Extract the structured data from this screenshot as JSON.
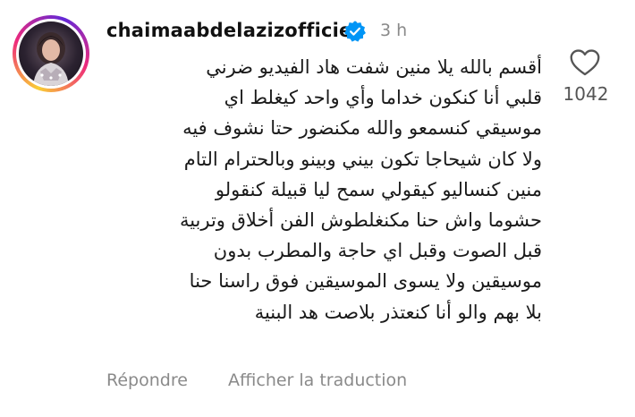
{
  "comment": {
    "author": {
      "username": "chaimaabdelazizofficiel",
      "verified": true,
      "verified_badge_icon": "verified-badge-icon",
      "avatar_icon": "profile-avatar",
      "story_ring_colors": [
        "#f9ce34",
        "#ee2a7b",
        "#6228d7"
      ]
    },
    "time_ago": "3 h",
    "text_lines": [
      "أقسم بالله يلا منين شفت هاد الفيديو ضرني",
      "قلبي أنا كنكون خداما وأي واحد كيغلط اي",
      "موسيقي كنسمعو والله مكنضور حتا نشوف فيه",
      "ولا كان شيحاجا تكون بيني وبينو وبالحترام التام",
      "منين كنساليو كيقولي سمح ليا قبيلة كنقولو",
      "حشوما واش حنا مكنغلطوش الفن أخلاق وتربية",
      "قبل الصوت وقبل اي حاجة والمطرب بدون",
      "موسيقين ولا يسوى الموسيقين فوق راسنا حنا",
      "بلا بهم والو أنا كنعتذر بلاصت هد البنية"
    ],
    "like": {
      "icon": "heart-icon",
      "count": "1042"
    },
    "actions": {
      "reply_label": "Répondre",
      "translate_label": "Afficher la traduction"
    },
    "colors": {
      "verified_blue": "#0095f6",
      "muted_text": "#8a8a8a",
      "main_text": "#1a1a1a"
    }
  }
}
